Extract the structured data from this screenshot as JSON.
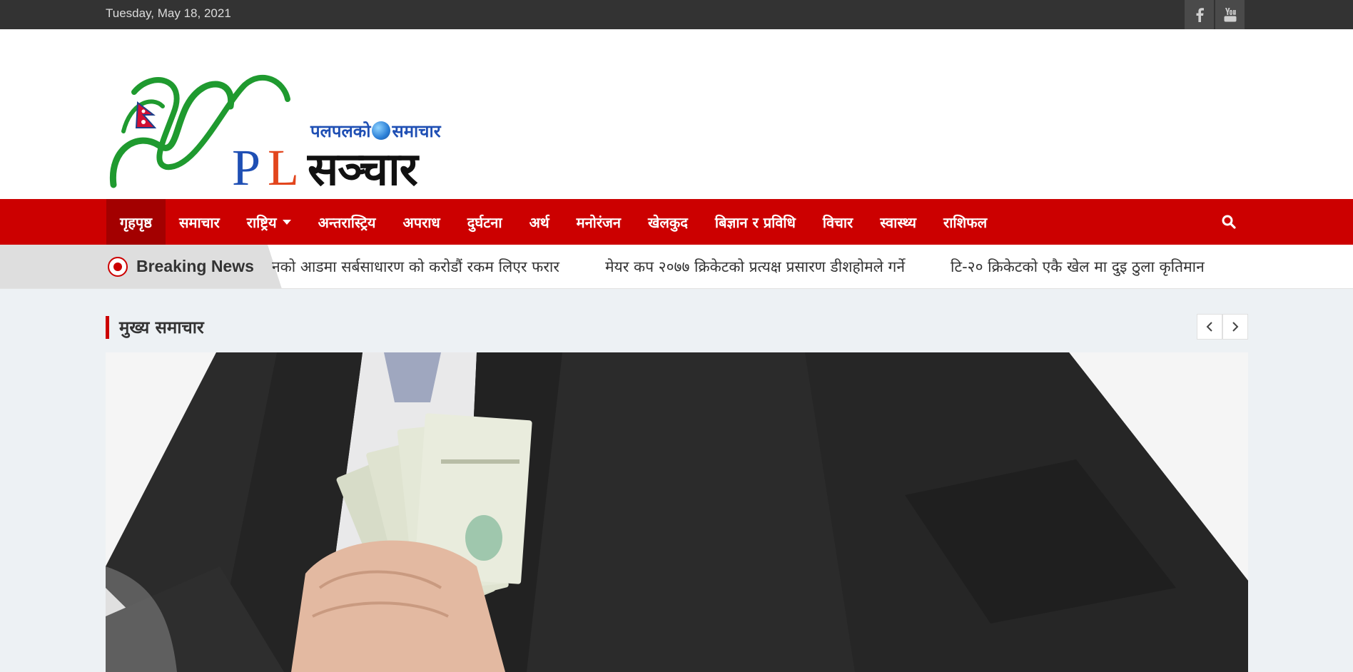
{
  "topbar": {
    "date": "Tuesday, May 18, 2021",
    "social": [
      {
        "icon": "facebook-icon"
      },
      {
        "icon": "youtube-icon"
      }
    ]
  },
  "logo": {
    "tagline_left": "पलपलको",
    "tagline_right": "समाचार",
    "main": "सञ्चार",
    "letters": [
      "N",
      "P",
      "L"
    ]
  },
  "nav": {
    "items": [
      {
        "label": "गृहपृष्ठ"
      },
      {
        "label": "समाचार"
      },
      {
        "label": "राष्ट्रिय"
      },
      {
        "label": "अन्तरास्ट्रिय"
      },
      {
        "label": "अपराध"
      },
      {
        "label": "दुर्घटना"
      },
      {
        "label": "अर्थ"
      },
      {
        "label": "मनोरंजन"
      },
      {
        "label": "खेलकुद"
      },
      {
        "label": "बिज्ञान र प्रविधि"
      },
      {
        "label": "विचार"
      },
      {
        "label": "स्वास्थ्य"
      },
      {
        "label": "राशिफल"
      }
    ],
    "search_icon": "search-icon"
  },
  "breaking": {
    "label": "Breaking News",
    "items": [
      "नको आडमा सर्बसाधारण को करोडौं रकम लिएर फरार",
      "मेयर कप २०७७ क्रिकेटको प्रत्यक्ष प्रसारण डीशहोमले गर्ने",
      "टि-२० क्रिकेटको एकै खेल मा दुइ ठुला कृतिमान"
    ]
  },
  "section": {
    "title": "मुख्य समाचार"
  },
  "colors": {
    "brand_red": "#cc0000",
    "topbar": "#333333",
    "page_bg": "#edf1f4"
  }
}
